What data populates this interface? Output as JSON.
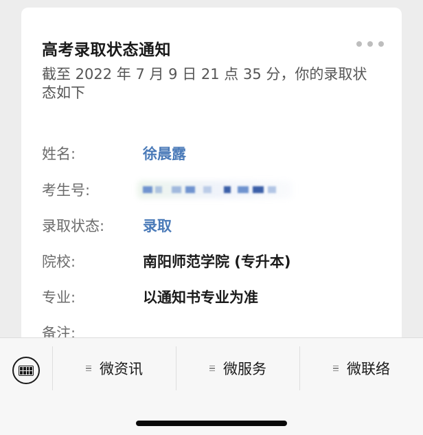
{
  "card": {
    "title": "高考录取状态通知",
    "description": "截至 2022 年 7 月 9 日 21 点 35 分，你的录取状态如下",
    "fields": [
      {
        "label": "姓名:",
        "value": "徐晨露"
      },
      {
        "label": "考生号:",
        "value": ""
      },
      {
        "label": "录取状态:",
        "value": "录取"
      },
      {
        "label": "院校:",
        "value": "南阳师范学院 (专升本)"
      },
      {
        "label": "专业:",
        "value": "以通知书专业为准"
      },
      {
        "label": "备注:",
        "value": ""
      }
    ]
  },
  "bottom_menu": {
    "items": [
      {
        "label": "微资讯"
      },
      {
        "label": "微服务"
      },
      {
        "label": "微联络"
      }
    ]
  },
  "icons": {
    "more": "more-dots-icon",
    "keyboard": "keyboard-icon",
    "menu": "menu-lines-icon"
  },
  "colors": {
    "link": "#4a7ab8",
    "background": "#ededed",
    "card": "#ffffff"
  }
}
